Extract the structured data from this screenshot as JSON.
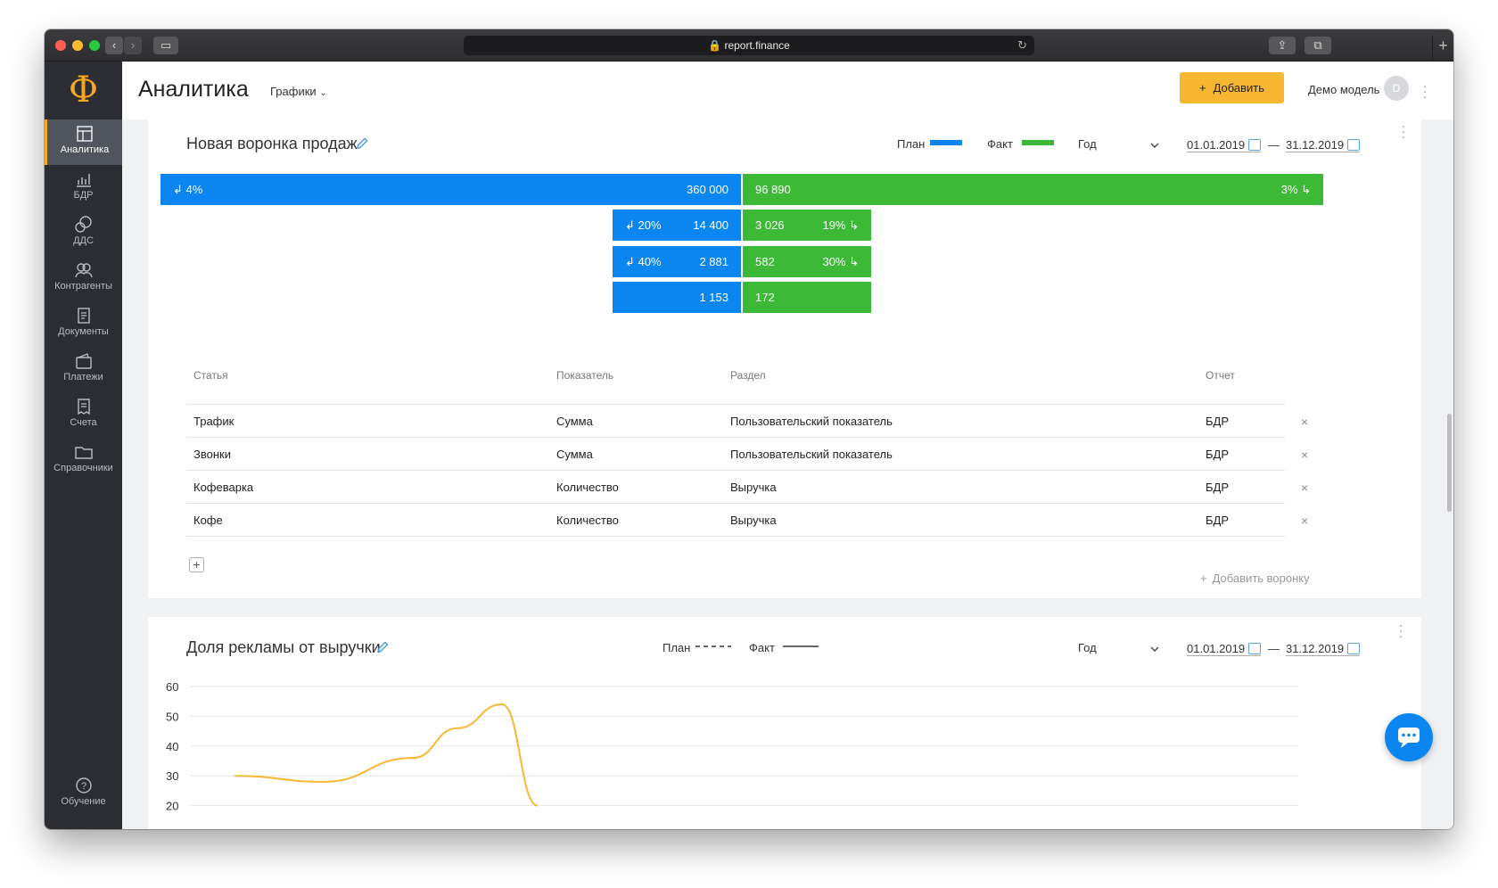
{
  "browser": {
    "url": "report.finance"
  },
  "app": {
    "logo": "Ф",
    "title": "Аналитика",
    "view_dropdown": "Графики",
    "add_button": "Добавить",
    "model_name": "Демо модель",
    "avatar_initial": "D"
  },
  "sidebar": {
    "items": [
      {
        "label": "Аналитика",
        "icon": "analytics-icon"
      },
      {
        "label": "БДР",
        "icon": "bar-chart-icon"
      },
      {
        "label": "ДДС",
        "icon": "coins-icon"
      },
      {
        "label": "Контрагенты",
        "icon": "contractors-icon"
      },
      {
        "label": "Документы",
        "icon": "documents-icon"
      },
      {
        "label": "Платежи",
        "icon": "wallet-icon"
      },
      {
        "label": "Счета",
        "icon": "invoice-icon"
      },
      {
        "label": "Справочники",
        "icon": "folder-icon"
      }
    ],
    "help": {
      "label": "Обучение",
      "icon": "help-icon"
    }
  },
  "funnel_card": {
    "title": "Новая воронка продаж",
    "legend_plan": "План",
    "legend_fact": "Факт",
    "period": "Год",
    "date_from": "01.01.2019",
    "date_sep": "—",
    "date_to": "31.12.2019",
    "colors": {
      "plan": "#0b86f0",
      "fact": "#3cb936"
    },
    "stages": [
      {
        "plan": "360 000",
        "fact": "96 890",
        "plan_conv": "4%",
        "fact_conv": "3%"
      },
      {
        "plan": "14 400",
        "fact": "3 026",
        "plan_conv": "20%",
        "fact_conv": "19%"
      },
      {
        "plan": "2 881",
        "fact": "582",
        "plan_conv": "40%",
        "fact_conv": "30%"
      },
      {
        "plan": "1 153",
        "fact": "172",
        "plan_conv": "",
        "fact_conv": ""
      }
    ],
    "table": {
      "headers": [
        "Статья",
        "Показатель",
        "Раздел",
        "Отчет"
      ],
      "rows": [
        [
          "Трафик",
          "Сумма",
          "Пользовательский показатель",
          "БДР"
        ],
        [
          "Звонки",
          "Сумма",
          "Пользовательский показатель",
          "БДР"
        ],
        [
          "Кофеварка",
          "Количество",
          "Выручка",
          "БДР"
        ],
        [
          "Кофе",
          "Количество",
          "Выручка",
          "БДР"
        ]
      ],
      "add_funnel": "Добавить воронку"
    }
  },
  "chart_card": {
    "title": "Доля рекламы от выручки",
    "legend_plan": "План",
    "legend_fact": "Факт",
    "period": "Год",
    "date_from": "01.01.2019",
    "date_sep": "—",
    "date_to": "31.12.2019",
    "line_color": "#f7b733"
  },
  "chart_data": {
    "type": "line",
    "series": [
      {
        "name": "Факт",
        "x": [
          0,
          1,
          2,
          2.5,
          3,
          3.4
        ],
        "values": [
          30,
          28,
          36,
          46,
          54,
          20
        ]
      }
    ],
    "y_ticks": [
      "60",
      "50",
      "40",
      "30",
      "20"
    ],
    "ylim": [
      20,
      60
    ],
    "grid": true
  }
}
